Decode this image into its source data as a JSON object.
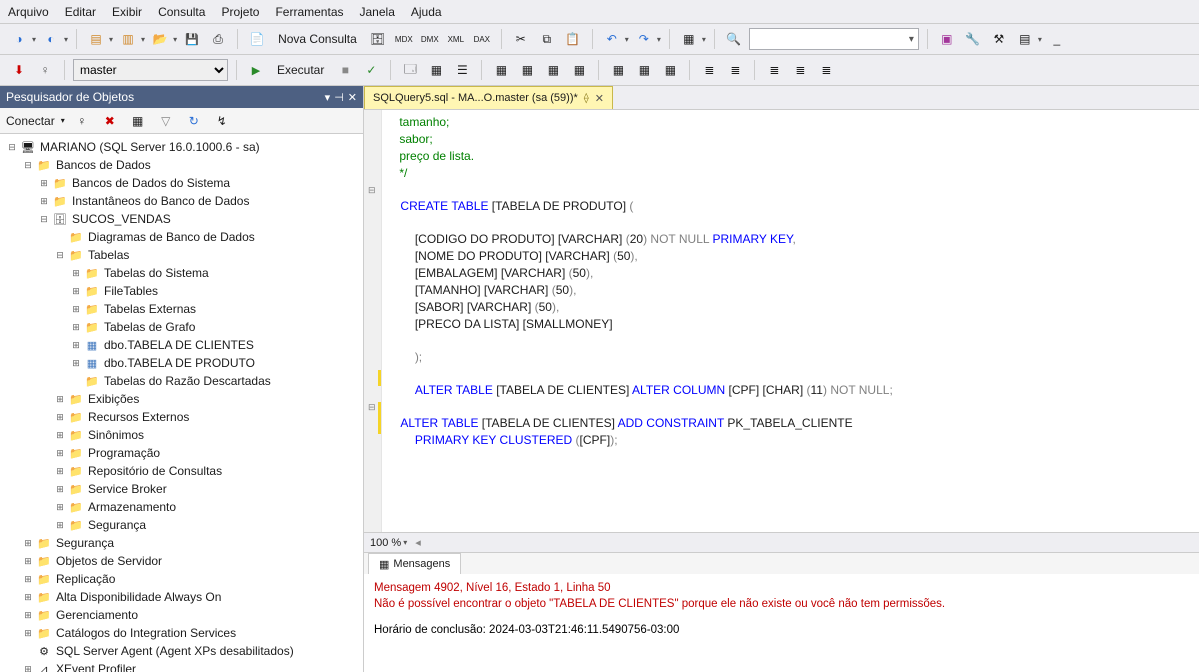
{
  "menu": [
    "Arquivo",
    "Editar",
    "Exibir",
    "Consulta",
    "Projeto",
    "Ferramentas",
    "Janela",
    "Ajuda"
  ],
  "toolbar1": {
    "nova_consulta": "Nova Consulta"
  },
  "toolbar2": {
    "db_combo": "master",
    "executar": "Executar"
  },
  "explorer": {
    "title": "Pesquisador de Objetos",
    "connect": "Conectar",
    "server": "MARIANO (SQL Server 16.0.1000.6 - sa)",
    "nodes": {
      "bancos": "Bancos de Dados",
      "bds_sistema": "Bancos de Dados do Sistema",
      "instant": "Instantâneos do Banco de Dados",
      "sucos": "SUCOS_VENDAS",
      "diagramas": "Diagramas de Banco de Dados",
      "tabelas": "Tabelas",
      "tab_sistema": "Tabelas do Sistema",
      "filetables": "FileTables",
      "tab_externas": "Tabelas Externas",
      "tab_grafo": "Tabelas de Grafo",
      "tab_clientes": "dbo.TABELA DE CLIENTES",
      "tab_produto": "dbo.TABELA DE PRODUTO",
      "tab_razao": "Tabelas do Razão Descartadas",
      "exibicoes": "Exibições",
      "recursos_ext": "Recursos Externos",
      "sinonimos": "Sinônimos",
      "programacao": "Programação",
      "repo_consultas": "Repositório de Consultas",
      "service_broker": "Service Broker",
      "armazenamento": "Armazenamento",
      "seguranca_db": "Segurança",
      "seguranca": "Segurança",
      "obj_servidor": "Objetos de Servidor",
      "replicacao": "Replicação",
      "alta_disp": "Alta Disponibilidade Always On",
      "gerenciamento": "Gerenciamento",
      "catalogos": "Catálogos do Integration Services",
      "sql_agent": "SQL Server Agent (Agent XPs desabilitados)",
      "xevent": "XEvent Profiler"
    }
  },
  "tab": {
    "label": "SQLQuery5.sql - MA...O.master (sa (59))*"
  },
  "code": {
    "l1": "tamanho;",
    "l2": "sabor;",
    "l3": "preço de lista.",
    "l4": "*/",
    "l5a": "CREATE",
    "l5b": " TABLE",
    "l5c": " [TABELA DE PRODUTO] ",
    "l5d": "(",
    "l6a": "[CODIGO DO PRODUTO] [VARCHAR] ",
    "l6b": "(",
    "l6c": "20",
    "l6d": ")",
    "l6e": " NOT NULL",
    "l6f": " PRIMARY KEY",
    "l6g": ",",
    "l7a": "[NOME DO PRODUTO] [VARCHAR] ",
    "l7b": "(",
    "l7c": "50",
    "l7d": ")",
    "l7e": ",",
    "l8a": "[EMBALAGEM] [VARCHAR] ",
    "l8b": "(",
    "l8c": "50",
    "l8d": ")",
    "l8e": ",",
    "l9a": "[TAMANHO] [VARCHAR] ",
    "l9b": "(",
    "l9c": "50",
    "l9d": ")",
    "l9e": ",",
    "l10a": "[SABOR] [VARCHAR] ",
    "l10b": "(",
    "l10c": "50",
    "l10d": ")",
    "l10e": ",",
    "l11": "[PRECO DA LISTA] [SMALLMONEY]",
    "l12": ");",
    "l13a": "ALTER",
    "l13b": " TABLE",
    "l13c": " [TABELA DE CLIENTES] ",
    "l13d": "ALTER",
    "l13e": " COLUMN",
    "l13f": " [CPF] [CHAR] ",
    "l13g": "(",
    "l13h": "11",
    "l13i": ")",
    "l13j": " NOT NULL",
    "l13k": ";",
    "l14a": "ALTER",
    "l14b": " TABLE",
    "l14c": " [TABELA DE CLIENTES] ",
    "l14d": "ADD",
    "l14e": " CONSTRAINT",
    "l14f": " PK_TABELA_CLIENTE",
    "l15a": "PRIMARY KEY",
    "l15b": " CLUSTERED",
    "l15c": " (",
    "l15d": "[CPF]",
    "l15e": ");"
  },
  "zoom": "100 %",
  "messages": {
    "tab": "Mensagens",
    "line1": "Mensagem 4902, Nível 16, Estado 1, Linha 50",
    "line2": "Não é possível encontrar o objeto \"TABELA DE CLIENTES\" porque ele não existe ou você não tem permissões.",
    "line3": "Horário de conclusão: 2024-03-03T21:46:11.5490756-03:00"
  }
}
